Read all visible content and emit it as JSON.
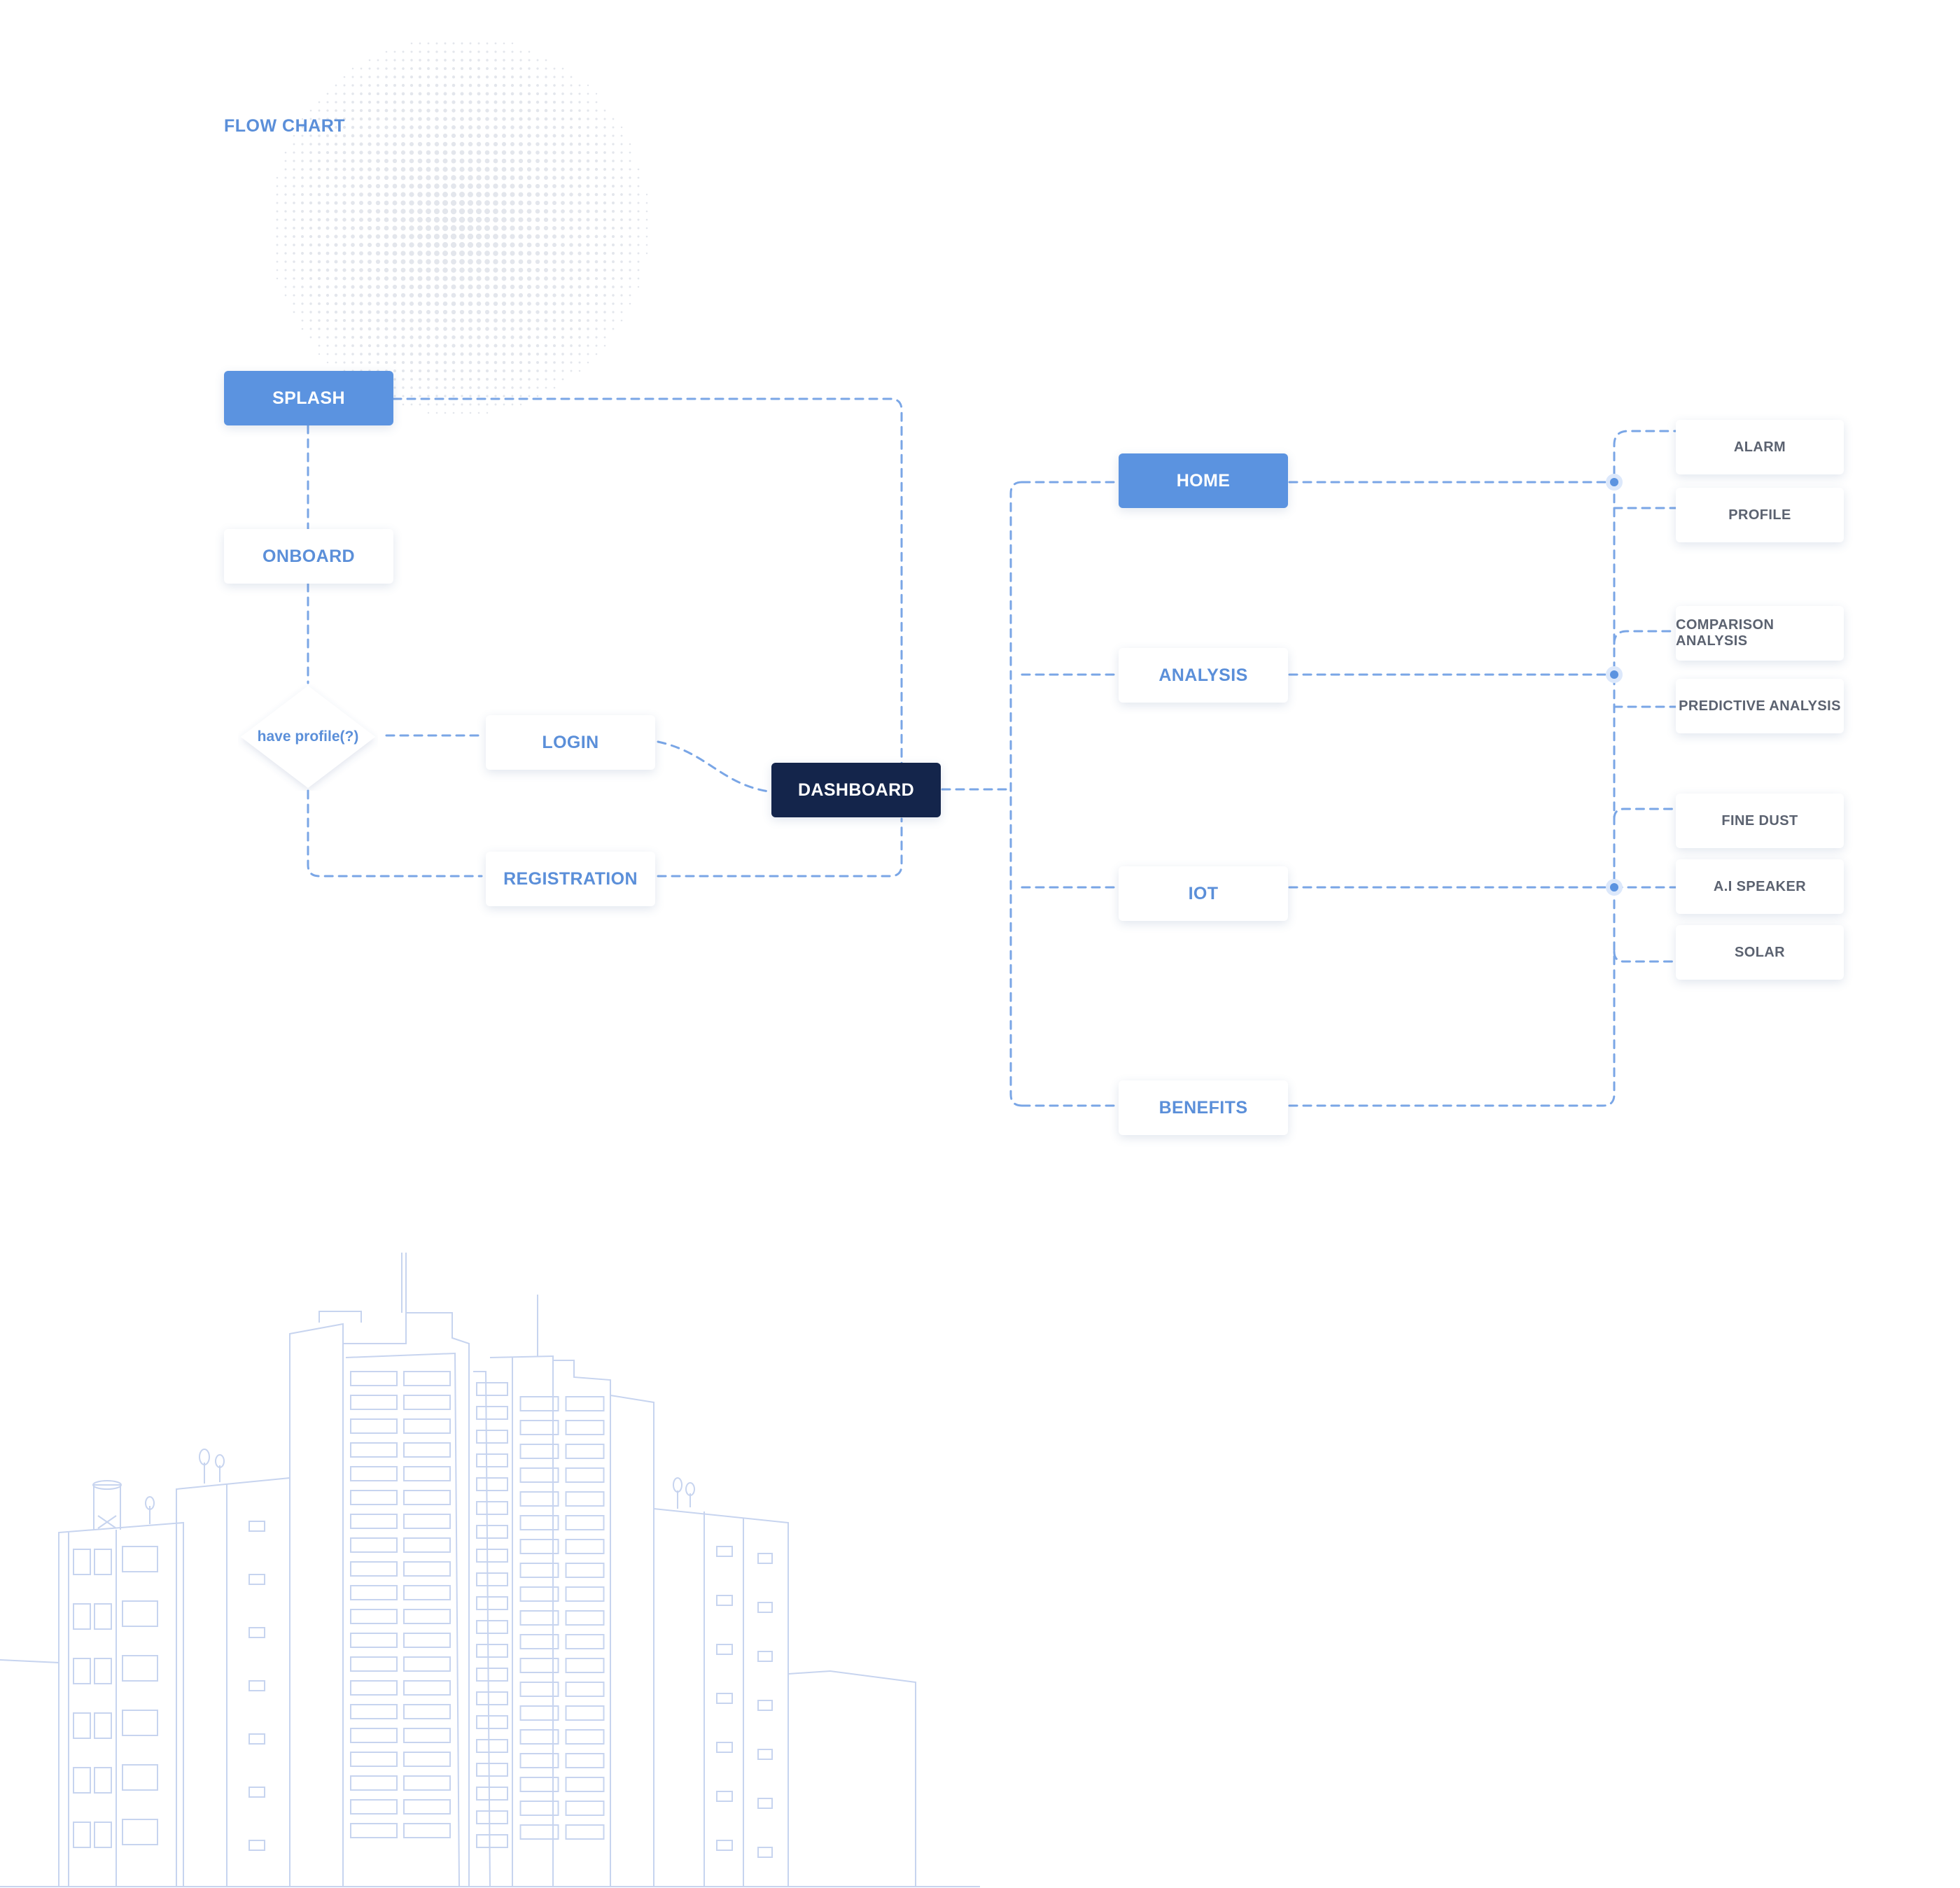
{
  "title": "FLOW CHART",
  "colors": {
    "accent": "#5b93e0",
    "accent_text": "#5b8fd9",
    "dark_node": "#14254b",
    "leaf_text": "#5b6270",
    "connector": "#7aa6e6",
    "illustration_line": "#c7d4ef"
  },
  "nodes": {
    "splash": "SPLASH",
    "onboard": "ONBOARD",
    "decision": "have profile(?)",
    "login": "LOGIN",
    "registration": "REGISTRATION",
    "dashboard": "DASHBOARD",
    "home": "HOME",
    "analysis": "ANALYSIS",
    "iot": "IOT",
    "benefits": "BENEFITS"
  },
  "leaves": {
    "alarm": "ALARM",
    "profile": "PROFILE",
    "comparison_analysis": "COMPARISON ANALYSIS",
    "predictive_analysis": "PREDICTIVE ANALYSIS",
    "fine_dust": "FINE DUST",
    "ai_speaker": "A.I SPEAKER",
    "solar": "SOLAR"
  },
  "decorations": {
    "dot_sphere": "halftone-dot-sphere",
    "skyline": "city-buildings-line-illustration"
  }
}
